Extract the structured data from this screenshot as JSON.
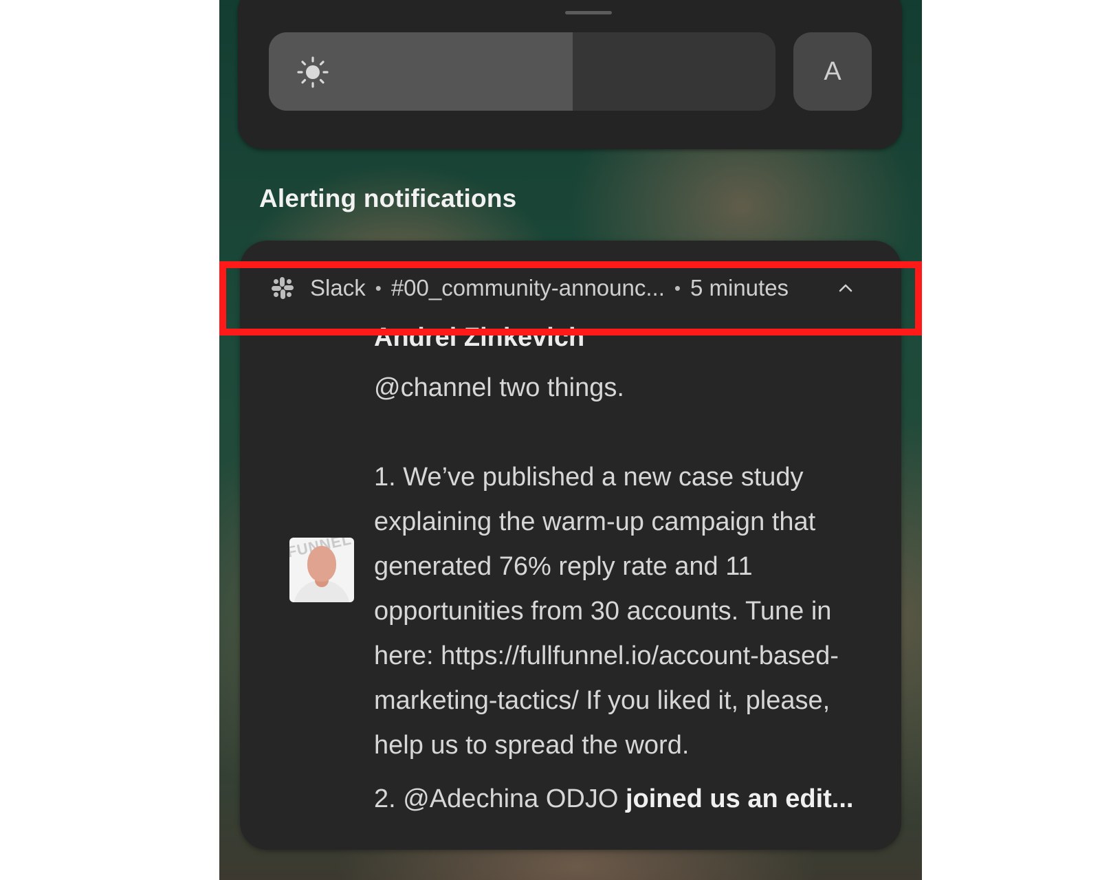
{
  "quick_settings": {
    "brightness_level": 0.6,
    "auto_button_label": "A"
  },
  "section_title": "Alerting notifications",
  "notification": {
    "app_name": "Slack",
    "separator": "•",
    "channel": "#00_community-announc...",
    "time": "5 minutes",
    "sender": "Andrei Zinkevich",
    "message": "@channel two things.\n\n1. We’ve published a new case study explaining the warm-up campaign that generated 76% reply rate and 11 opportunities from 30 accounts. Tune in here: https://fullfunnel.io/account-based-marketing-tactics/ If you liked it, please, help us to spread the word.",
    "message_tail_plain": "2. @Adechina ODJO ",
    "message_tail_bold": "joined us an edit...",
    "avatar_watermark": "FUNNEL"
  },
  "colors": {
    "highlight_border": "#ff1a1a",
    "card_background": "#262626",
    "panel_background": "#242424"
  },
  "icons": {
    "brightness": "sun-icon",
    "app": "slack-icon",
    "collapse": "chevron-up-icon"
  }
}
